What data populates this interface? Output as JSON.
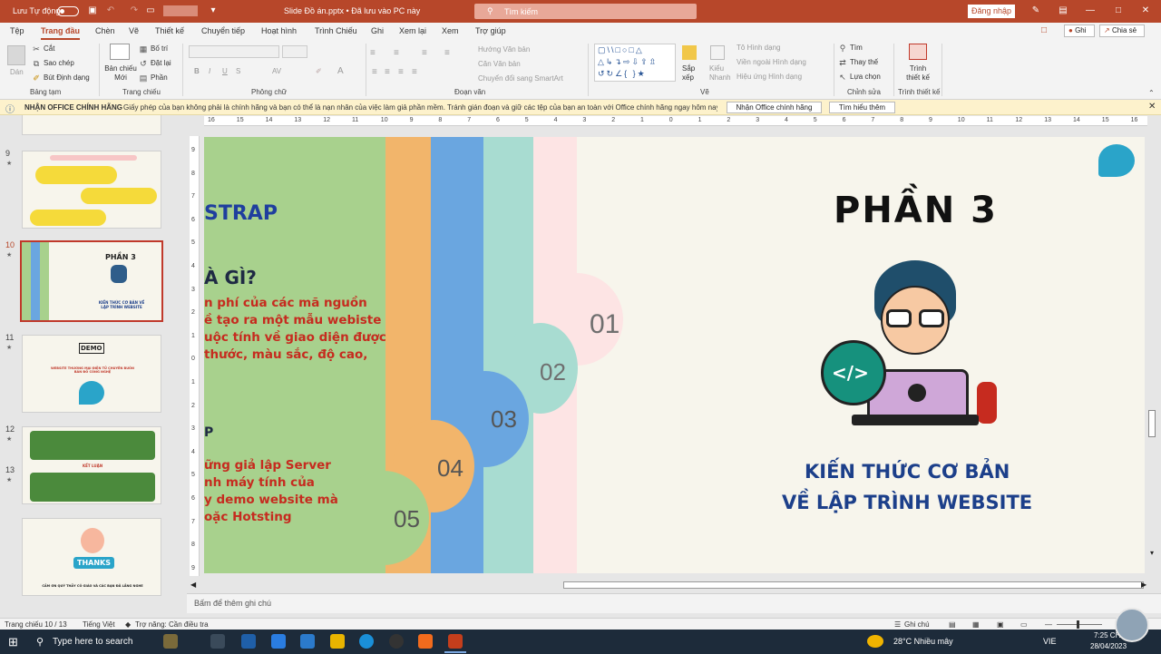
{
  "titlebar": {
    "autosave": "Lưu Tự động",
    "doc_title": "Slide Đồ án.pptx • Đã lưu vào PC này",
    "search_placeholder": "Tìm kiếm",
    "signin": "Đăng nhập"
  },
  "tabs": [
    "Tệp",
    "Trang đầu",
    "Chèn",
    "Vẽ",
    "Thiết kế",
    "Chuyển tiếp",
    "Hoạt hình",
    "Trình Chiếu",
    "Ghi",
    "Xem lại",
    "Xem",
    "Trợ giúp"
  ],
  "tabs_right": {
    "record": "Ghi",
    "share": "Chia sẻ"
  },
  "ribbon": {
    "paste": "Dán",
    "cut": "Cắt",
    "copy": "Sao chép",
    "format_painter": "Bút Định dạng",
    "group_clipboard": "Bảng tạm",
    "new_slide": "Bản chiếu Mới",
    "layout": "Bố trí",
    "reset": "Đặt lại",
    "section": "Phần",
    "group_slides": "Trang chiếu",
    "group_font": "Phông chữ",
    "text_direction": "Hướng Văn bản",
    "align_text": "Căn Văn bản",
    "smartart": "Chuyển đổi sang SmartArt",
    "group_paragraph": "Đoạn văn",
    "arrange": "Sắp xếp",
    "styles": "Kiểu Nhanh",
    "shape_fill": "Tô Hình dạng",
    "shape_outline": "Viền ngoài Hình dạng",
    "shape_effects": "Hiệu ứng Hình dạng",
    "group_draw": "Vẽ",
    "find": "Tìm",
    "replace": "Thay thế",
    "select": "Lựa chọn",
    "group_editing": "Chỉnh sửa",
    "designer": "Trình thiết kế",
    "group_designer": "Trình thiết kế"
  },
  "msgbar": {
    "title": "NHẬN OFFICE CHÍNH HÃNG",
    "text": "Giấy phép của bạn không phải là chính hãng và bạn có thể là nạn nhân của việc làm giả phần mềm. Tránh gián đoạn và giữ các tệp của bạn an toàn với Office chính hãng ngay hôm nay.",
    "btn1": "Nhận Office chính hãng",
    "btn2": "Tìm hiểu thêm"
  },
  "thumbs": [
    {
      "num": "9"
    },
    {
      "num": "10",
      "title": "PHẦN 3",
      "sub": "KIẾN THỨC CƠ BẢN VỀ LẬP TRÌNH WEBSITE"
    },
    {
      "num": "11",
      "title": "DEMO",
      "sub": "WEBSITE THƯƠNG MẠI ĐIỆN TỬ CHUYÊN BUÔN BÁN ĐỒ CÔNG NGHỆ"
    },
    {
      "num": "12",
      "title": "KẾT LUẬN"
    },
    {
      "num": "13",
      "title": "THANKS",
      "sub": "CẢM ƠN QUÝ THẦY CÔ GIÁO VÀ CÁC BẠN ĐÃ LẮNG NGHE"
    }
  ],
  "ruler_h": [
    "16",
    "15",
    "14",
    "13",
    "12",
    "11",
    "10",
    "9",
    "8",
    "7",
    "6",
    "5",
    "4",
    "3",
    "2",
    "1",
    "0",
    "1",
    "2",
    "3",
    "4",
    "5",
    "6",
    "7",
    "8",
    "9",
    "10",
    "11",
    "12",
    "13",
    "14",
    "15",
    "16"
  ],
  "ruler_v": [
    "9",
    "8",
    "7",
    "6",
    "5",
    "4",
    "3",
    "2",
    "1",
    "0",
    "1",
    "2",
    "3",
    "4",
    "5",
    "6",
    "7",
    "8",
    "9"
  ],
  "slide": {
    "left_heading": "STRAP",
    "left_question": "À GÌ?",
    "left_body": [
      "n phí của các mã nguồn",
      "ề tạo ra một mẫu webiste",
      "uộc tính về giao diện được",
      "thước, màu sắc, độ cao,"
    ],
    "left_p": "P",
    "left_body2": [
      "ững giả lập Server",
      "nh máy tính của",
      "y demo website mà",
      "oặc Hotsting"
    ],
    "tabs": [
      "01",
      "02",
      "03",
      "04",
      "05"
    ],
    "title": "PHẦN 3",
    "sub1": "KIẾN THỨC CƠ BẢN",
    "sub2": "VỀ LẬP TRÌNH WEBSITE",
    "code_glyph": "</>"
  },
  "notes": "Bấm để thêm ghi chú",
  "status": {
    "slide": "Trang chiếu 10 / 13",
    "lang": "Tiếng Việt",
    "access": "Trợ năng: Cần điều tra",
    "notes_btn": "Ghi chú"
  },
  "taskbar": {
    "search": "Type here to search",
    "weather": "28°C  Nhiều mây",
    "lang": "VIE",
    "time": "7:25 CH",
    "date": "28/04/2023"
  },
  "colors": {
    "accent": "#b7472a",
    "green": "#a8d18d",
    "orange": "#f2b56b",
    "blue": "#6aa6e0",
    "teal": "#a8dcd1",
    "pink": "#fde4e4",
    "red": "#d62b1f"
  }
}
